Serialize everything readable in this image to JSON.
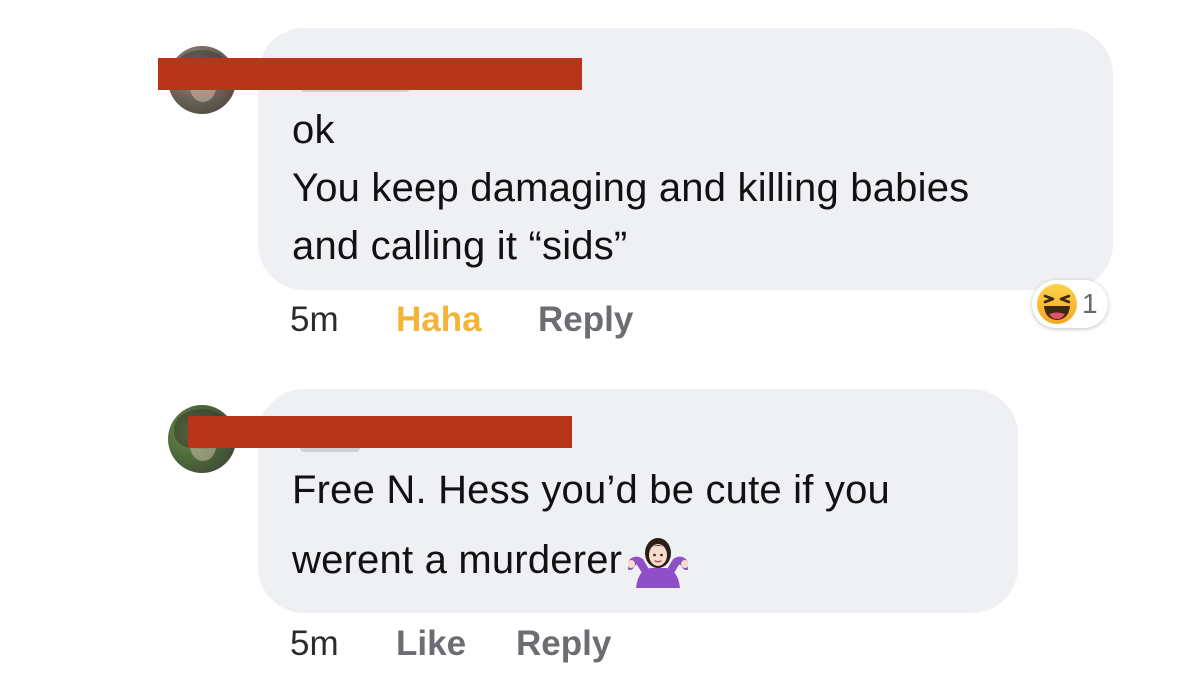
{
  "comments": [
    {
      "author_redacted": true,
      "text_lines": [
        "ok",
        "You keep damaging and killing babies",
        "and calling it “sids”"
      ],
      "timestamp": "5m",
      "like_label": "Haha",
      "reply_label": "Reply",
      "reaction": {
        "icon": "haha-emoji-icon",
        "count": "1"
      },
      "accent_color": "#f2b53a"
    },
    {
      "author_redacted": true,
      "text_lines": [
        "Free N. Hess you’d be cute if you",
        "werent a murderer"
      ],
      "text_trailing_emoji": "woman-shrugging-emoji-icon",
      "timestamp": "5m",
      "like_label": "Like",
      "reply_label": "Reply"
    }
  ],
  "colors": {
    "bubble": "#eff0f3",
    "redaction": "#b8351a",
    "action_gray": "#6b6d72"
  }
}
